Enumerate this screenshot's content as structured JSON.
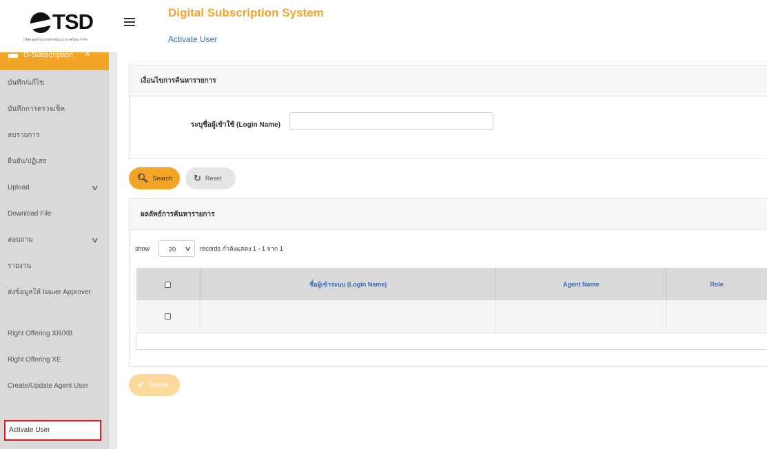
{
  "logo": {
    "text": "TSD",
    "subtitle": "บริษัท ศูนย์รับฝากหลักทรัพย์ (ประเทศไทย) จำกัด"
  },
  "header": {
    "app_title": "Digital Subscription System",
    "page_title": "Activate User",
    "menu_icon": "hamburger-icon"
  },
  "sidebar": {
    "group_label": "D-Subscription",
    "items": [
      {
        "label": "บันทึก/แก้ไข",
        "chevron": false
      },
      {
        "label": "บันทึกการตรวจเช็ค",
        "chevron": false
      },
      {
        "label": "ลบรายการ",
        "chevron": false
      },
      {
        "label": "ยืนยัน/ปฏิเสธ",
        "chevron": false
      },
      {
        "label": "Upload",
        "chevron": true
      },
      {
        "label": "Download File",
        "chevron": false
      },
      {
        "label": "สอบถาม",
        "chevron": true
      },
      {
        "label": "รายงาน",
        "chevron": false
      },
      {
        "label": "ส่งข้อมูลให้ Issuer Approver",
        "chevron": false
      },
      {
        "label": "Right Offering XR/XB",
        "chevron": false
      },
      {
        "label": "Right Offering XE",
        "chevron": false
      },
      {
        "label": "Create/Update Agent User",
        "chevron": false
      },
      {
        "label": "Activate User",
        "chevron": false
      }
    ]
  },
  "criteria": {
    "title": "เงื่อนไขการค้นหารายการ",
    "login_label": "ระบุชื่อผู้เข้าใช้ (Login Name)",
    "login_value": ""
  },
  "buttons": {
    "search": "Search",
    "reset": "Reset",
    "submit": "Submit"
  },
  "results": {
    "title": "ผลลัพธ์การค้นหารายการ",
    "show_label": "show",
    "page_size": "20",
    "records_text": "records  กำลังแสดง 1 - 1 จาก 1",
    "columns": [
      "",
      "ชื่อผู้เข้าระบบ (Login Name)",
      "Agent Name",
      "Role"
    ],
    "rows": [
      [
        "",
        "",
        "",
        ""
      ]
    ]
  },
  "colors": {
    "accent": "#f3a527",
    "link": "#2b6cc4",
    "active_outline": "#e0151b"
  }
}
